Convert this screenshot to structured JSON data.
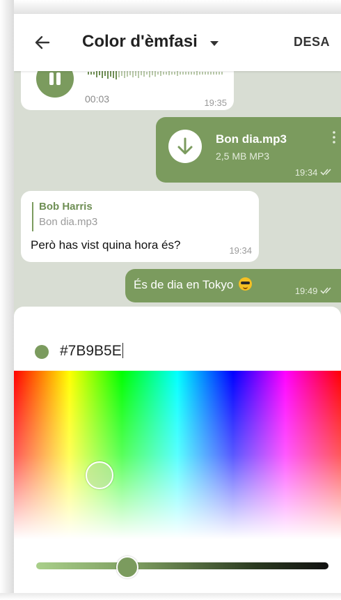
{
  "header": {
    "title": "Color d'èmfasi",
    "save_label": "DESA"
  },
  "chat": {
    "voice": {
      "duration": "00:03",
      "time": "19:35"
    },
    "file": {
      "name": "Bon dia.mp3",
      "size": "2,5 MB MP3",
      "time": "19:34"
    },
    "reply": {
      "author": "Bob Harris",
      "quoted": "Bon dia.mp3",
      "text": "Però has vist quina hora és?",
      "time": "19:34"
    },
    "last": {
      "text": "És de dia en Tokyo",
      "time": "19:49"
    }
  },
  "picker": {
    "hex_value": "#7B9B5E",
    "accent_color": "#7b9b5e",
    "brightness_level": 0.32
  },
  "icons": [
    "back-arrow-icon",
    "chevron-down-icon",
    "pause-icon",
    "download-icon",
    "more-vert-icon",
    "double-check-icon",
    "sunglasses-emoji-icon"
  ]
}
